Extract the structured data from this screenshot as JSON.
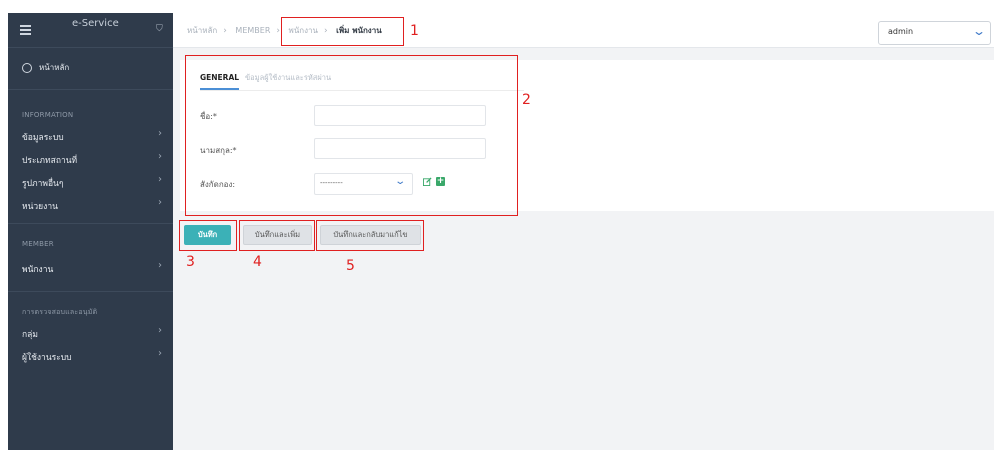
{
  "sidebar": {
    "brand": "e-Service",
    "home": "หน้าหลัก",
    "sections": [
      {
        "title": "INFORMATION",
        "items": [
          "ข้อมูลระบบ",
          "ประเภทสถานที่",
          "รูปภาพอื่นๆ",
          "หน่วยงาน"
        ]
      },
      {
        "title": "MEMBER",
        "items": [
          "พนักงาน"
        ]
      },
      {
        "title": "การตรวจสอบและอนุมัติ",
        "items": [
          "กลุ่ม",
          "ผู้ใช้งานระบบ"
        ]
      }
    ]
  },
  "header": {
    "breadcrumb": [
      "หน้าหลัก",
      "MEMBER",
      "พนักงาน",
      "เพิ่ม พนักงาน"
    ],
    "user": "admin"
  },
  "form": {
    "tabs": [
      "GENERAL",
      "ข้อมูลผู้ใช้งานและรหัสผ่าน"
    ],
    "first_name_label": "ชื่อ:*",
    "last_name_label": "นามสกุล:*",
    "department_label": "สังกัดกอง:",
    "department_value": "---------"
  },
  "buttons": {
    "save": "บันทึก",
    "save_add": "บันทึกและเพิ่ม",
    "save_back": "บันทึกและกลับมาแก้ไข"
  },
  "annotations": [
    "1",
    "2",
    "3",
    "4",
    "5"
  ],
  "colors": {
    "sidebar": "#2f3b4b",
    "accent": "#3bb1b7",
    "annotation": "#e02020",
    "tab_underline": "#4b8fd6"
  }
}
